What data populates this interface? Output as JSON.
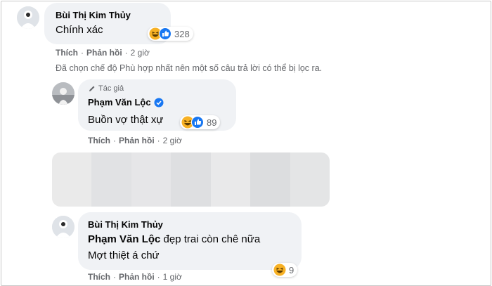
{
  "comments": [
    {
      "author": "Bùi Thị Kim Thủy",
      "lines": [
        "Chính xác"
      ],
      "reactions": {
        "icons": [
          "haha-icon",
          "like-icon"
        ],
        "count": "328"
      },
      "actions": {
        "like": "Thích",
        "reply": "Phản hồi",
        "time": "2 giờ"
      }
    },
    {
      "badge": "Tác giả",
      "author": "Phạm Văn Lộc",
      "verified": true,
      "lines": [
        "Buồn vợ thật xự"
      ],
      "reactions": {
        "icons": [
          "haha-icon",
          "like-icon"
        ],
        "count": "89"
      },
      "actions": {
        "like": "Thích",
        "reply": "Phản hồi",
        "time": "2 giờ"
      }
    },
    {
      "author": "Bùi Thị Kim Thủy",
      "mention": "Phạm Văn Lộc",
      "lines": [
        " đẹp trai còn chê nữa",
        "Mợt thiệt á chứ"
      ],
      "reactions": {
        "icons": [
          "haha-icon"
        ],
        "count": "9"
      },
      "actions": {
        "like": "Thích",
        "reply": "Phản hồi",
        "time": "1 giờ"
      }
    }
  ],
  "filter_notice": "Đã chọn chế độ Phù hợp nhất nên một số câu trả lời có thể bị lọc ra.",
  "colors": {
    "accent": "#1877f2",
    "bubble": "#f0f2f5",
    "meta": "#65676b",
    "haha": "#f7b125"
  }
}
